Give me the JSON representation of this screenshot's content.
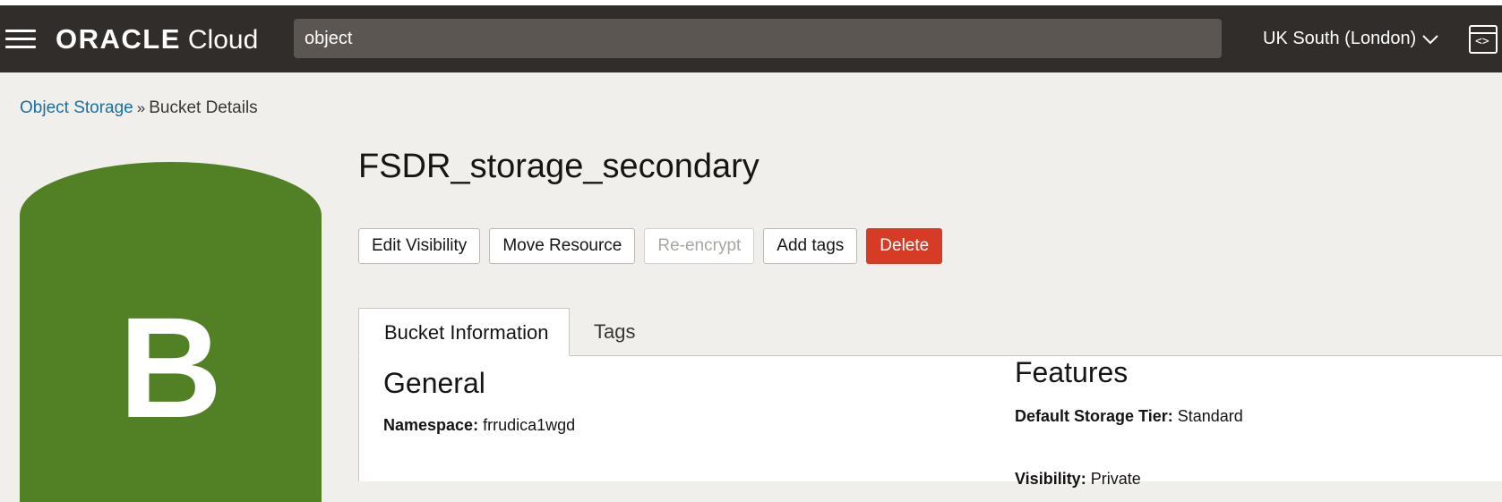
{
  "header": {
    "brand": "ORACLE",
    "product": "Cloud",
    "search_value": "object",
    "region": "UK South (London)"
  },
  "breadcrumb": {
    "parent": "Object Storage",
    "separator": "»",
    "current": "Bucket Details"
  },
  "bucket": {
    "icon_letter": "B",
    "icon_color": "#518025",
    "name": "FSDR_storage_secondary"
  },
  "actions": {
    "edit_visibility": "Edit Visibility",
    "move_resource": "Move Resource",
    "reencrypt": "Re-encrypt",
    "add_tags": "Add tags",
    "delete": "Delete"
  },
  "tabs": {
    "bucket_information": "Bucket Information",
    "tags": "Tags"
  },
  "general": {
    "title": "General",
    "namespace_label": "Namespace:",
    "namespace_value": "frrudica1wgd"
  },
  "features": {
    "title": "Features",
    "storage_tier_label": "Default Storage Tier:",
    "storage_tier_value": "Standard",
    "visibility_label": "Visibility:",
    "visibility_value": "Private"
  },
  "colors": {
    "header_bg": "#312d2a",
    "link": "#1b6fa0",
    "danger": "#d63b25"
  }
}
